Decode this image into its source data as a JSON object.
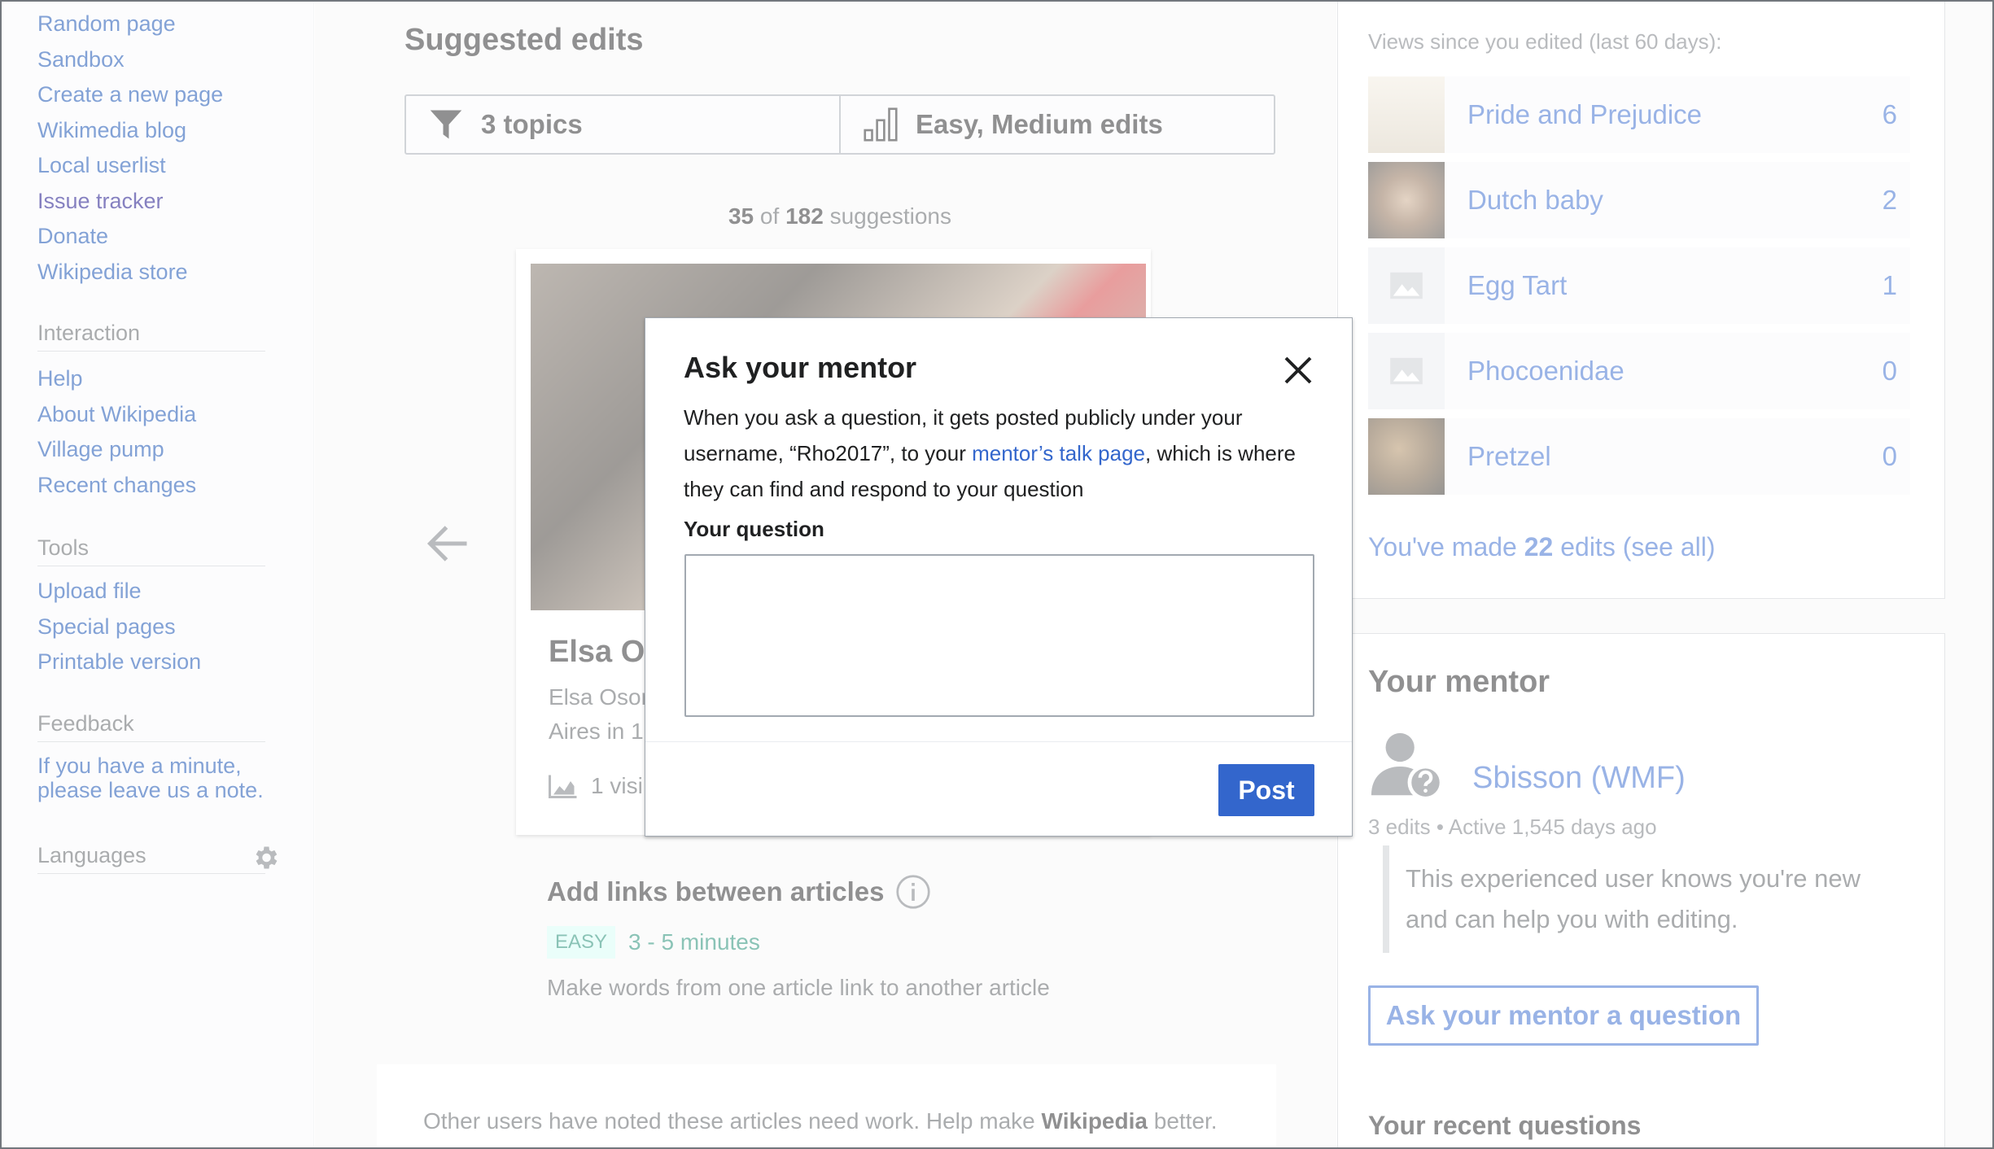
{
  "sidebar": {
    "nav_links": [
      {
        "label": "Random page"
      },
      {
        "label": "Sandbox"
      },
      {
        "label": "Create a new page"
      },
      {
        "label": "Wikimedia blog"
      },
      {
        "label": "Local userlist"
      },
      {
        "label": "Issue tracker"
      },
      {
        "label": "Donate"
      },
      {
        "label": "Wikipedia store"
      }
    ],
    "interaction": {
      "heading": "Interaction",
      "links": [
        {
          "label": "Help"
        },
        {
          "label": "About Wikipedia"
        },
        {
          "label": "Village pump"
        },
        {
          "label": "Recent changes"
        }
      ]
    },
    "tools": {
      "heading": "Tools",
      "links": [
        {
          "label": "Upload file"
        },
        {
          "label": "Special pages"
        },
        {
          "label": "Printable version"
        }
      ]
    },
    "feedback": {
      "heading": "Feedback",
      "link": "If you have a minute, please leave us a note."
    },
    "languages": {
      "heading": "Languages",
      "icon": "gear-icon"
    }
  },
  "suggested_edits": {
    "title": "Suggested edits",
    "topics_filter": "3 topics",
    "difficulty_filter": "Easy, Medium edits",
    "count_current": "35",
    "count_of": "of",
    "count_total": "182",
    "count_suffix": "suggestions",
    "card": {
      "title": "Elsa O",
      "extract_line1": "Elsa Osor",
      "extract_line2": "Aires in 1",
      "views": "1 visi"
    },
    "task": {
      "title": "Add links between articles",
      "difficulty": "EASY",
      "time": "3 - 5 minutes",
      "description": "Make words from one article link to another article"
    },
    "footer_text": "Other users have noted these articles need work. Help make",
    "footer_brand": "Wikipedia",
    "footer_end": "better."
  },
  "impact": {
    "heading": "Views since you edited (last 60 days):",
    "articles": [
      {
        "title": "Pride and Prejudice",
        "views": "6"
      },
      {
        "title": "Dutch baby",
        "views": "2"
      },
      {
        "title": "Egg Tart",
        "views": "1"
      },
      {
        "title": "Phocoenidae",
        "views": "0"
      },
      {
        "title": "Pretzel",
        "views": "0"
      }
    ],
    "edits_prefix": "You've made",
    "edits_count": "22",
    "edits_suffix": "edits (see all)"
  },
  "mentor": {
    "heading": "Your mentor",
    "name": "Sbisson (WMF)",
    "edits": "3 edits",
    "separator": "•",
    "active": "Active 1,545 days ago",
    "quote": "This experienced user knows you're new and can help you with editing.",
    "ask_button": "Ask your mentor a question",
    "recent_heading": "Your recent questions"
  },
  "dialog": {
    "title": "Ask your mentor",
    "body_before": "When you ask a question, it gets posted publicly under your username, “Rho2017”, to your ",
    "body_link": "mentor’s talk page",
    "body_after": ", which is where they can find and respond to your question",
    "label": "Your question",
    "textarea_value": "",
    "post_button": "Post"
  },
  "colors": {
    "link": "#0645ad",
    "progressive": "#3366cc",
    "easy_badge_bg": "#d5fdf4",
    "easy_text": "#14866d"
  }
}
